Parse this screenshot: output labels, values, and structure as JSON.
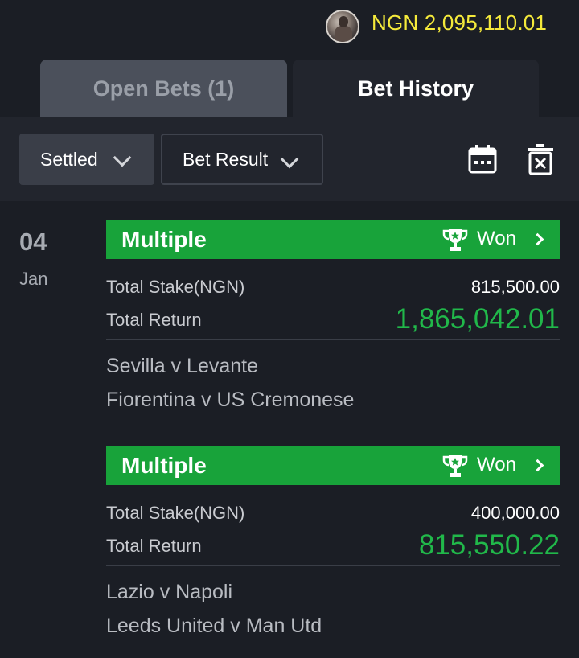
{
  "header": {
    "balance": "NGN 2,095,110.01"
  },
  "tabs": [
    {
      "label": "Open Bets (1)"
    },
    {
      "label": "Bet History"
    }
  ],
  "filters": {
    "status_label": "Settled",
    "result_label": "Bet Result"
  },
  "icons": {
    "calendar": "calendar-icon",
    "delete": "trash-icon",
    "trophy": "trophy-icon"
  },
  "colors": {
    "balance": "#f5ea3b",
    "won_banner": "#18a33a",
    "return_amount": "#21b84a"
  },
  "group": {
    "day": "04",
    "month": "Jan"
  },
  "bets": [
    {
      "type": "Multiple",
      "status": "Won",
      "stake_label": "Total Stake(NGN)",
      "stake": "815,500.00",
      "return_label": "Total Return",
      "return": "1,865,042.01",
      "matches": [
        "Sevilla v Levante",
        "Fiorentina v US Cremonese"
      ]
    },
    {
      "type": "Multiple",
      "status": "Won",
      "stake_label": "Total Stake(NGN)",
      "stake": "400,000.00",
      "return_label": "Total Return",
      "return": "815,550.22",
      "matches": [
        "Lazio v Napoli",
        "Leeds United v Man Utd"
      ]
    }
  ]
}
